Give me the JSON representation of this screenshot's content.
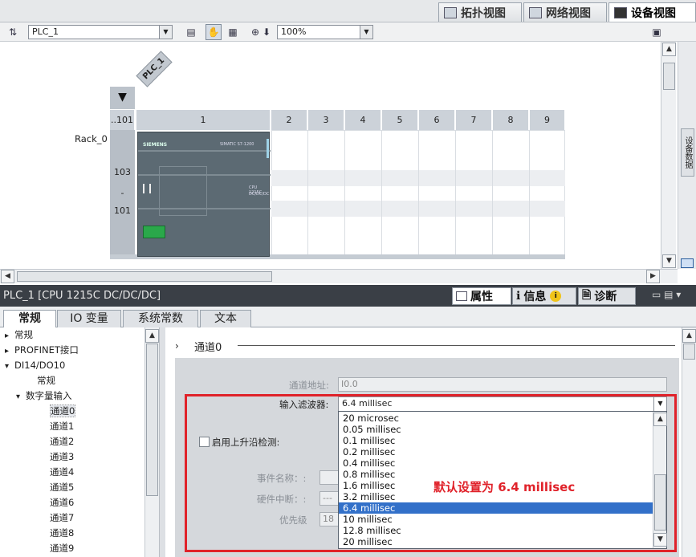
{
  "view_tabs": [
    {
      "label": "拓扑视图",
      "active": false
    },
    {
      "label": "网络视图",
      "active": false
    },
    {
      "label": "设备视图",
      "active": true
    }
  ],
  "toolbar": {
    "device_select": "PLC_1",
    "zoom": "100%"
  },
  "canvas": {
    "plc_tag": "PLC_1",
    "rack_label": "Rack_0",
    "slot_first": "..101",
    "slots": [
      "1",
      "2",
      "3",
      "4",
      "5",
      "6",
      "7",
      "8",
      "9"
    ],
    "left_rail": [
      "103",
      "-",
      "101"
    ],
    "module_brand": "SIEMENS",
    "module_name": "SIMATIC S7-1200",
    "module_cpu": "CPU 1215C",
    "module_type": "DC/DC/DC",
    "side_tab": "设备数据"
  },
  "properties": {
    "title": "PLC_1 [CPU 1215C DC/DC/DC]",
    "tabs": [
      "属性",
      "信息",
      "诊断"
    ],
    "subtabs": [
      "常规",
      "IO 变量",
      "系统常数",
      "文本"
    ]
  },
  "tree": [
    {
      "label": "常规",
      "level": 0,
      "arrow": "▸"
    },
    {
      "label": "PROFINET接口",
      "level": 0,
      "arrow": "▸"
    },
    {
      "label": "DI14/DO10",
      "level": 0,
      "arrow": "▾"
    },
    {
      "label": "常规",
      "level": 1,
      "arrow": ""
    },
    {
      "label": "数字量输入",
      "level": 1,
      "arrow": "▾"
    },
    {
      "label": "通道0",
      "level": 2,
      "arrow": "",
      "selected": true
    },
    {
      "label": "通道1",
      "level": 2,
      "arrow": ""
    },
    {
      "label": "通道2",
      "level": 2,
      "arrow": ""
    },
    {
      "label": "通道3",
      "level": 2,
      "arrow": ""
    },
    {
      "label": "通道4",
      "level": 2,
      "arrow": ""
    },
    {
      "label": "通道5",
      "level": 2,
      "arrow": ""
    },
    {
      "label": "通道6",
      "level": 2,
      "arrow": ""
    },
    {
      "label": "通道7",
      "level": 2,
      "arrow": ""
    },
    {
      "label": "通道8",
      "level": 2,
      "arrow": ""
    },
    {
      "label": "通道9",
      "level": 2,
      "arrow": ""
    }
  ],
  "form": {
    "section_arrow": "›",
    "section_title": "通道0",
    "address_label": "通道地址:",
    "address_value": "I0.0",
    "filter_label": "输入滤波器:",
    "filter_value": "6.4 millisec",
    "rising_edge_label": "启用上升沿检测:",
    "event_label": "事件名称：:",
    "hw_int_label": "硬件中断：:",
    "hw_int_value": "---",
    "priority_label": "优先级",
    "priority_value": "18"
  },
  "filter_options": [
    "20 microsec",
    "0.05 millisec",
    "0.1 millisec",
    "0.2 millisec",
    "0.4 millisec",
    "0.8 millisec",
    "1.6 millisec",
    "3.2 millisec",
    "6.4 millisec",
    "10 millisec",
    "12.8 millisec",
    "20 millisec"
  ],
  "filter_selected_index": 8,
  "annotation": "默认设置为 6.4 millisec",
  "colors": {
    "accent": "#3270c9",
    "highlight": "#e0222a",
    "rack": "#ccd2d9",
    "module": "#5c6a73"
  }
}
